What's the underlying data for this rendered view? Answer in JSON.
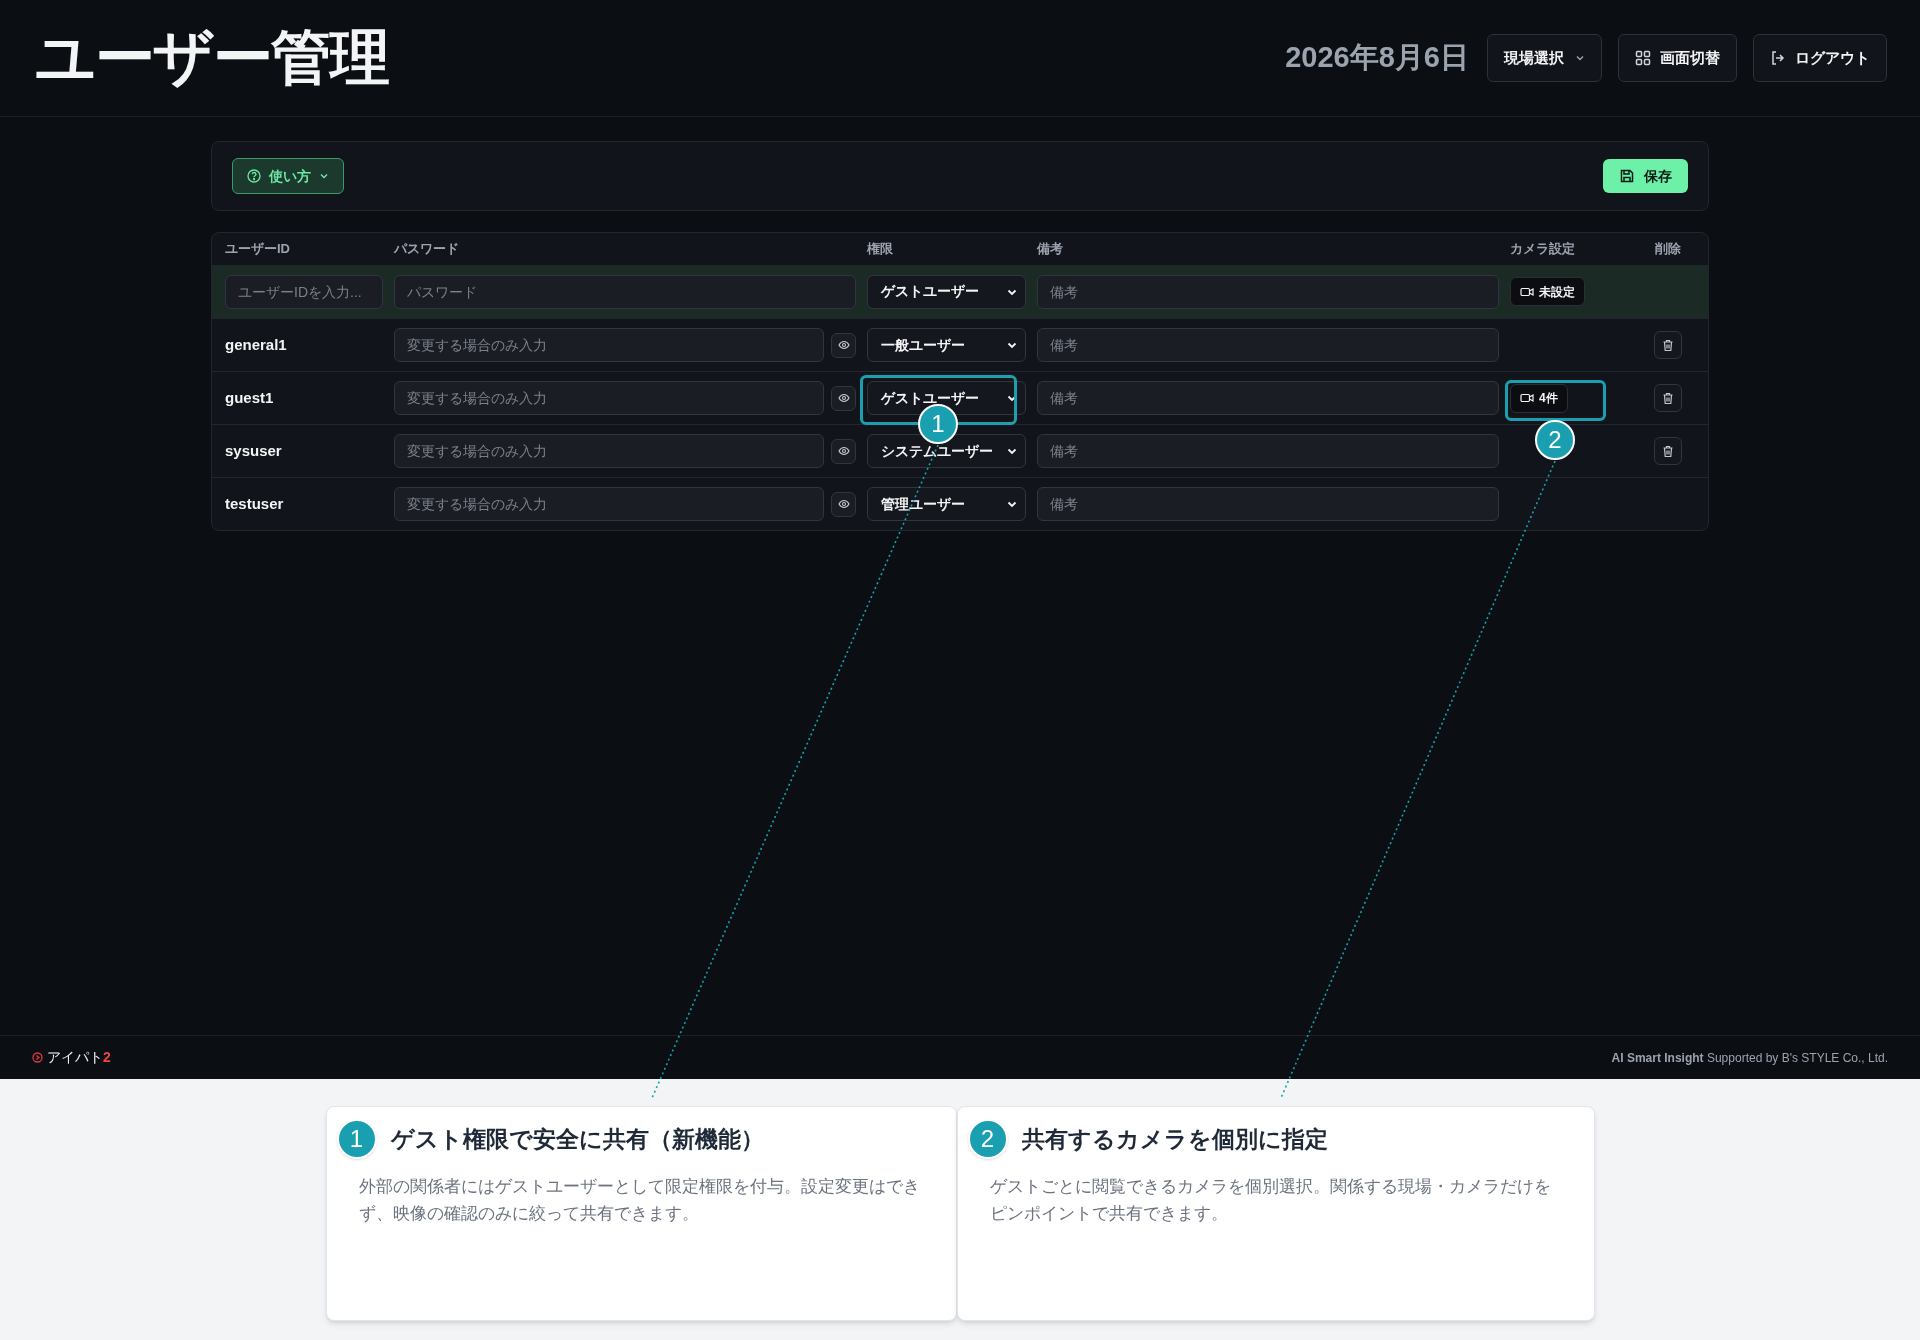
{
  "header": {
    "title": "ユーザー管理",
    "date": "2026年8月6日",
    "buttons": [
      {
        "label": "現場選択"
      },
      {
        "label": "画面切替"
      },
      {
        "label": "ログアウト"
      }
    ]
  },
  "toolbar": {
    "help_button": "使い方",
    "save_button": "保存"
  },
  "table": {
    "columns": [
      "ユーザーID",
      "パスワード",
      "権限",
      "備考",
      "カメラ設定",
      "削除"
    ],
    "new_row": {
      "user_id_placeholder": "ユーザーIDを入力...",
      "password_placeholder": "パスワード",
      "role": "ゲストユーザー",
      "notes_placeholder": "備考",
      "camera": "未設定"
    },
    "rows": [
      {
        "user_id": "general1",
        "password_placeholder": "変更する場合のみ入力",
        "role": "一般ユーザー",
        "notes_placeholder": "備考",
        "deletable": true
      },
      {
        "user_id": "guest1",
        "password_placeholder": "変更する場合のみ入力",
        "role": "ゲストユーザー",
        "notes_placeholder": "備考",
        "camera": "4件",
        "deletable": true
      },
      {
        "user_id": "sysuser",
        "password_placeholder": "変更する場合のみ入力",
        "role": "システムユーザー",
        "notes_placeholder": "備考",
        "deletable": true
      },
      {
        "user_id": "testuser",
        "password_placeholder": "変更する場合のみ入力",
        "role": "管理ユーザー",
        "notes_placeholder": "備考",
        "deletable": false
      }
    ]
  },
  "footer": {
    "logo": "アイパト",
    "logo_accent": "2",
    "credit": "**AI Smart Insight** Supported by B's STYLE Co., Ltd."
  },
  "callouts": [
    {
      "marker": "1",
      "number": "1",
      "title": "ゲスト権限で安全に共有（新機能）",
      "body": "外部の関係者にはゲストユーザーとして限定権限を付与。設定変更はできず、映像の確認のみに絞って共有できます。"
    },
    {
      "marker": "2",
      "number": "2",
      "title": "共有するカメラを個別に指定",
      "body": "ゲストごとに閲覧できるカメラを個別選択。関係する現場・カメラだけをピンポイントで共有できます。"
    }
  ]
}
